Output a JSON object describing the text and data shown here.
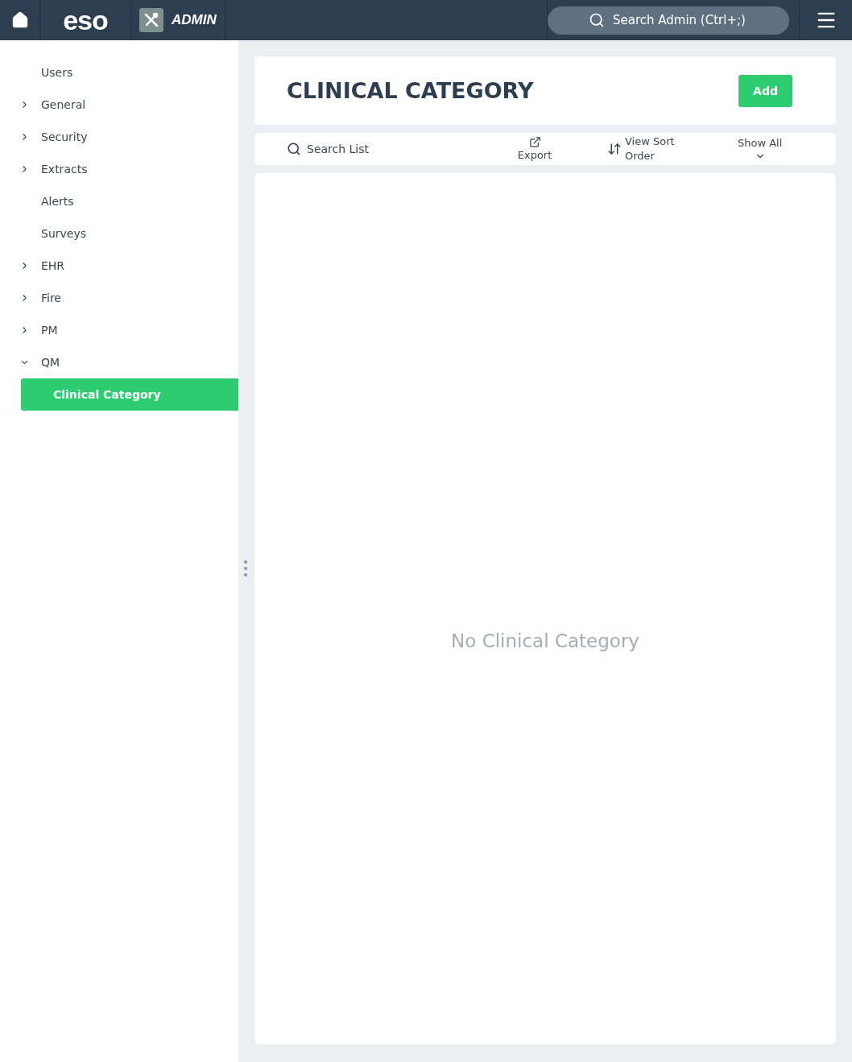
{
  "header": {
    "logo": "eso",
    "app_name": "ADMIN",
    "search": {
      "placeholder": "Search Admin (Ctrl+;)"
    }
  },
  "sidebar": {
    "items": [
      {
        "label": "Users",
        "kind": "link",
        "selected": false
      },
      {
        "label": "General",
        "kind": "group",
        "expanded": false,
        "selected": false
      },
      {
        "label": "Security",
        "kind": "group",
        "expanded": false,
        "selected": false
      },
      {
        "label": "Extracts",
        "kind": "group",
        "expanded": false,
        "selected": false
      },
      {
        "label": "Alerts",
        "kind": "link",
        "selected": false
      },
      {
        "label": "Surveys",
        "kind": "link",
        "selected": false
      },
      {
        "label": "EHR",
        "kind": "group",
        "expanded": false,
        "selected": false
      },
      {
        "label": "Fire",
        "kind": "group",
        "expanded": false,
        "selected": false
      },
      {
        "label": "PM",
        "kind": "group",
        "expanded": false,
        "selected": false
      },
      {
        "label": "QM",
        "kind": "group",
        "expanded": true,
        "selected": false,
        "children": [
          {
            "label": "Clinical Category",
            "selected": true
          }
        ]
      }
    ]
  },
  "page": {
    "title": "CLINICAL CATEGORY",
    "add_button": "Add"
  },
  "toolbar": {
    "search": {
      "placeholder": "Search List"
    },
    "export": "Export",
    "sort": "View Sort Order",
    "filter": "Show All"
  },
  "empty_message": "No Clinical Category"
}
